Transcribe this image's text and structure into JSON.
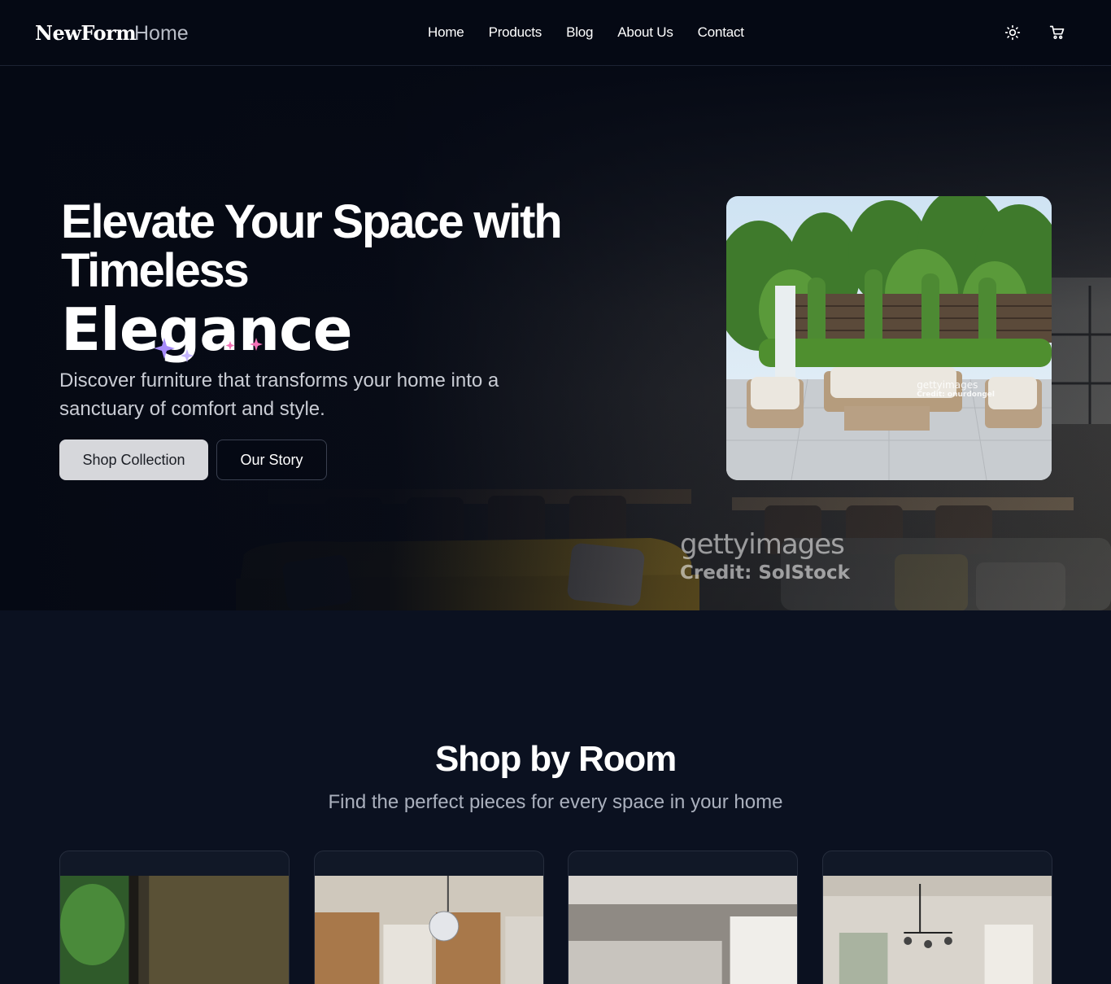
{
  "nav": {
    "brand": "NewForm",
    "brand_sub": "Home",
    "links": [
      "Home",
      "Products",
      "Blog",
      "About Us",
      "Contact"
    ],
    "icons": [
      "sun-icon",
      "cart-icon"
    ]
  },
  "hero": {
    "title": "Elevate Your Space with Timeless",
    "accent": "Elegance",
    "description": "Discover furniture that transforms your home into a sanctuary of comfort and style.",
    "primary_button": "Shop Collection",
    "secondary_button": "Our Story",
    "bg_watermark_brand": "gettyimages",
    "bg_watermark_credit": "Credit: SolStock",
    "card_watermark_brand": "gettyimages",
    "card_watermark_credit": "Credit: onurdongel"
  },
  "rooms": {
    "title": "Shop by Room",
    "subtitle": "Find the perfect pieces for every space in your home"
  },
  "colors": {
    "background": "#0b1120",
    "nav_bg": "#050914",
    "primary_button_bg": "#d6d7db",
    "sofa_yellow": "#c9a227"
  }
}
